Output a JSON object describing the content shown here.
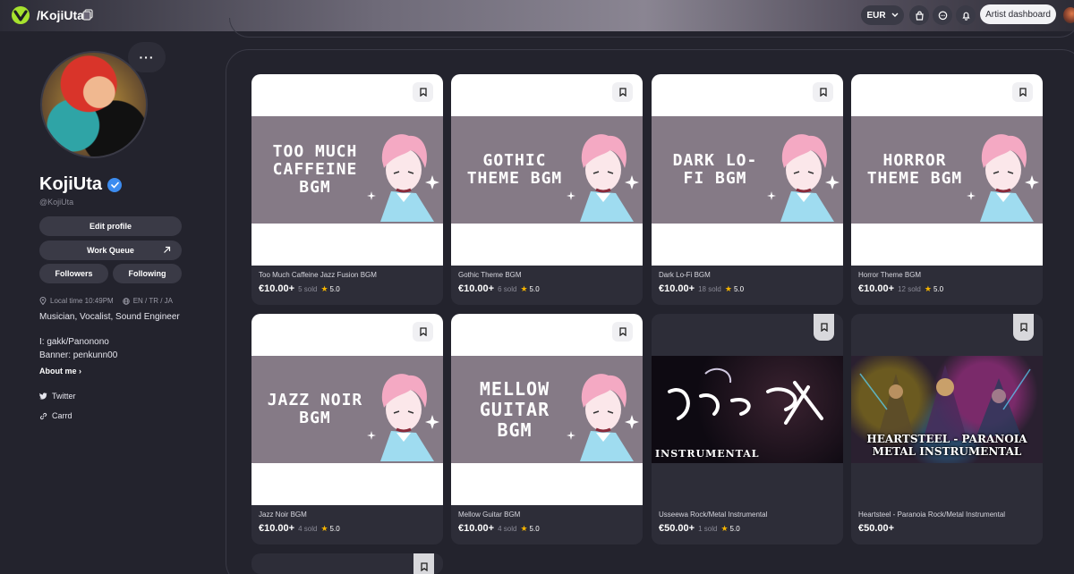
{
  "topbar": {
    "brand": "/KojiUta",
    "currency": "EUR",
    "artist_dashboard": "Artist dashboard"
  },
  "profile": {
    "name": "KojiUta",
    "handle": "@KojiUta",
    "more": "···",
    "edit_profile": "Edit profile",
    "work_queue": "Work Queue",
    "followers": "Followers",
    "following": "Following",
    "local_time": "Local time 10:49PM",
    "languages": "EN / TR / JA",
    "bio_line1": "Musician, Vocalist, Sound Engineer",
    "bio_line2": "I: gakk/Panonono",
    "bio_line3": "Banner: penkunn00",
    "about_me": "About me",
    "twitter": "Twitter",
    "carrd": "Carrd"
  },
  "products": [
    {
      "thumb_text": "Too Much Caffeine BGM",
      "title": "Too Much Caffeine Jazz Fusion BGM",
      "price": "€10.00+",
      "sold": "5 sold",
      "rating": "5.0"
    },
    {
      "thumb_text": "Gothic Theme BGM",
      "title": "Gothic Theme BGM",
      "price": "€10.00+",
      "sold": "6 sold",
      "rating": "5.0"
    },
    {
      "thumb_text": "Dark Lo-Fi BGM",
      "title": "Dark Lo-Fi BGM",
      "price": "€10.00+",
      "sold": "18 sold",
      "rating": "5.0"
    },
    {
      "thumb_text": "Horror Theme BGM",
      "title": "Horror Theme BGM",
      "price": "€10.00+",
      "sold": "12 sold",
      "rating": "5.0"
    },
    {
      "thumb_text": "Jazz Noir BGM",
      "title": "Jazz Noir BGM",
      "price": "€10.00+",
      "sold": "4 sold",
      "rating": "5.0"
    },
    {
      "thumb_text": "Mellow Guitar BGM",
      "title": "Mellow Guitar BGM",
      "price": "€10.00+",
      "sold": "4 sold",
      "rating": "5.0"
    },
    {
      "thumb_text": "INSTRUMENTAL",
      "title": "Usseewa Rock/Metal Instrumental",
      "price": "€50.00+",
      "sold": "1 sold",
      "rating": "5.0"
    },
    {
      "thumb_text": "HEARTSTEEL - PARANOIA METAL INSTRUMENTAL",
      "title": "Heartsteel - Paranoia Rock/Metal Instrumental",
      "price": "€50.00+",
      "sold": "",
      "rating": ""
    }
  ],
  "colors": {
    "background": "#23232d",
    "card": "#2d2d38",
    "thumb_bg": "#857a86",
    "star": "#f5b400",
    "verified": "#3c8cf0",
    "logo_green": "#a6e22e"
  }
}
